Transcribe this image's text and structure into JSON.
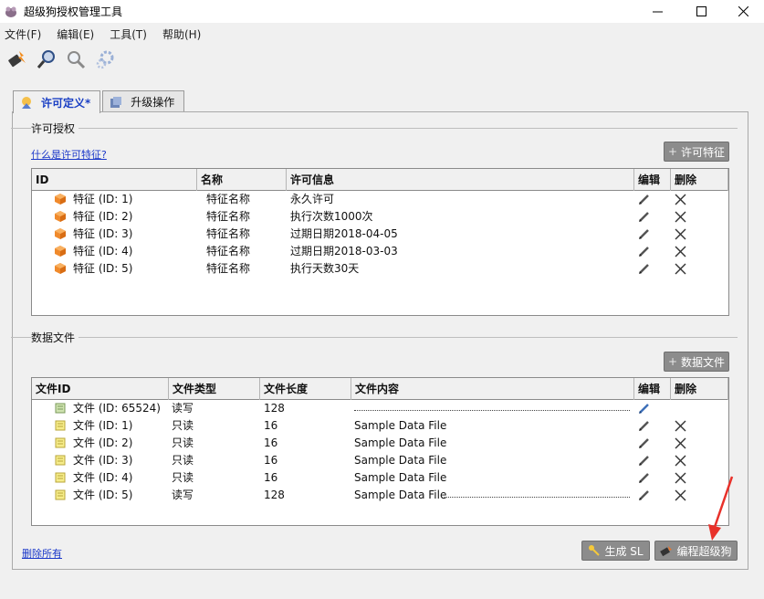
{
  "window": {
    "title": "超级狗授权管理工具"
  },
  "menu": [
    "文件(F)",
    "编辑(E)",
    "工具(T)",
    "帮助(H)"
  ],
  "toolbar": [
    "flash-icon",
    "search-icon",
    "zoom-icon",
    "settings-icon"
  ],
  "tabs": [
    {
      "label": "许可定义*",
      "active": true
    },
    {
      "label": "升级操作",
      "active": false
    }
  ],
  "license_section": {
    "title": "许可授权",
    "help_link": "什么是许可特征?",
    "add_button": "许可特征",
    "columns": [
      "ID",
      "名称",
      "许可信息",
      "编辑",
      "删除"
    ],
    "rows": [
      {
        "id": "特征 (ID: 1)",
        "name": "特征名称",
        "info": "永久许可"
      },
      {
        "id": "特征 (ID: 2)",
        "name": "特征名称",
        "info": "执行次数1000次"
      },
      {
        "id": "特征 (ID: 3)",
        "name": "特征名称",
        "info": "过期日期2018-04-05"
      },
      {
        "id": "特征 (ID: 4)",
        "name": "特征名称",
        "info": "过期日期2018-03-03"
      },
      {
        "id": "特征 (ID: 5)",
        "name": "特征名称",
        "info": "执行天数30天"
      }
    ]
  },
  "data_section": {
    "title": "数据文件",
    "add_button": "数据文件",
    "columns": [
      "文件ID",
      "文件类型",
      "文件长度",
      "文件内容",
      "编辑",
      "删除"
    ],
    "rows": [
      {
        "id": "文件 (ID: 65524)",
        "type": "读写",
        "length": "128",
        "content": ""
      },
      {
        "id": "文件 (ID: 1)",
        "type": "只读",
        "length": "16",
        "content": "Sample Data File"
      },
      {
        "id": "文件 (ID: 2)",
        "type": "只读",
        "length": "16",
        "content": "Sample Data File"
      },
      {
        "id": "文件 (ID: 3)",
        "type": "只读",
        "length": "16",
        "content": "Sample Data File"
      },
      {
        "id": "文件 (ID: 4)",
        "type": "只读",
        "length": "16",
        "content": "Sample Data File"
      },
      {
        "id": "文件 (ID: 5)",
        "type": "读写",
        "length": "128",
        "content": "Sample Data File"
      }
    ]
  },
  "footer": {
    "delete_all": "删除所有",
    "generate_button": "生成 SL",
    "program_button": "编程超级狗"
  },
  "colors": {
    "link": "#1b38c9",
    "active_tab": "#1a3fc4",
    "button_gray": "#8c8c8c",
    "arrow": "#e8312a"
  }
}
